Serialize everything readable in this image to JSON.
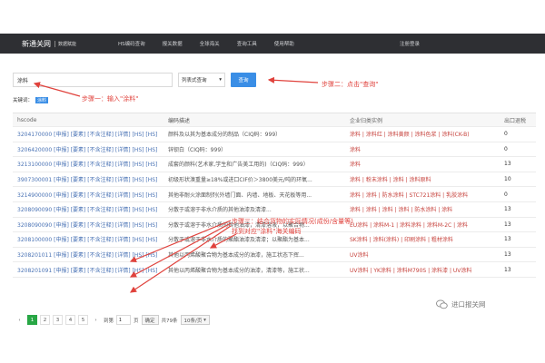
{
  "navbar": {
    "brand": "新通关网",
    "brand_sub": "数据赋能",
    "items": [
      "HS编码查询",
      "报关数据",
      "全球海关",
      "查询工具",
      "使用帮助"
    ],
    "right": "注册登录"
  },
  "search": {
    "value": "涂料",
    "mode": "列表式查询",
    "button": "查询"
  },
  "keyword": {
    "label": "关键词：",
    "tag": "涂料"
  },
  "annotations": {
    "step1": "步骤一：输入\"涂料\"",
    "step2": "步骤二：点击\"查询\"",
    "step3_line1": "步骤三：结合货物的实际情况(成份/含量等)",
    "step3_line2": "找到对应\"涂料\"海关编码"
  },
  "table": {
    "headers": [
      "hscode",
      "编码描述",
      "企业归类实例",
      "出口退税"
    ],
    "rows": [
      {
        "code": "3204170000",
        "links": "[申报] [要素] [不含注释] [详情] [HS] [HS]",
        "desc": "颜料及以其为基本成分的制品（CIQ码：999）",
        "examples": "涂料 | 涂料红 | 涂料黄颜 | 涂料色浆 | 涂料(CK-B)",
        "rebate": "0"
      },
      {
        "code": "3206420000",
        "links": "[申报] [要素] [不含注释] [详情] [HS] [HS]",
        "desc": "锌钡白（CIQ码：999）",
        "examples": "涂料",
        "rebate": "0"
      },
      {
        "code": "3213100000",
        "links": "[申报] [要素] [不含注释] [详情] [HS] [HS]",
        "desc": "成套的颜料(艺术家,学生和广告美工用的)（CIQ码：999）",
        "examples": "涂料",
        "rebate": "13"
      },
      {
        "code": "3907300001",
        "links": "[申报] [要素] [不含注释] [详情] [HS] [HS]",
        "desc": "初级形状溴重量≥18%或进口CIF价＞3800美元/吨的环氧...",
        "examples": "涂料 | 粉末涂料 | 涂料 | 涂料原料",
        "rebate": "10"
      },
      {
        "code": "3214900000",
        "links": "[申报] [要素] [不含注释] [详情] [HS] [HS]",
        "desc": "其他非耐火涂面制剂(外墙门面、内墙、地板、天花板等用...",
        "examples": "涂料 | 涂料 | 防水涂料 | STC721涂料 | 乳胶涂料",
        "rebate": "0"
      },
      {
        "code": "3208090090",
        "links": "[申报] [要素] [不含注释] [详情] [HS] [HS]",
        "desc": "分散于或溶于非水介质的其他油漆及清漆...",
        "examples": "涂料 | 涂料 | 涂料 | 涂料 | 防水涂料 | 涂料",
        "rebate": "13"
      },
      {
        "code": "3208090090",
        "links": "[申报] [要素] [不含注释] [详情] [HS] [HS]",
        "desc": "分散于或溶于非水介质的其他油漆，清漆溶液，以聚合物...",
        "examples": "EU涂料 | 涂料M-1 | 涂料涂料 | 涂料M-2C | 涂料",
        "rebate": "13"
      },
      {
        "code": "3208100000",
        "links": "[申报] [要素] [不含注释] [详情] [HS] [HS]",
        "desc": "分散于或溶于非水介质的聚酯油漆及清漆；以聚酯为基本...",
        "examples": "SK涂料 | 涂料(涂料) | 印刷涂料 | 粗材涂料",
        "rebate": "13"
      },
      {
        "code": "3208201011",
        "links": "[申报] [要素] [不含注释] [详情] [HS] [HS]",
        "desc": "其他以丙烯酸聚合物为基本成分的油漆，施工状态下挥...",
        "examples": "UV涂料",
        "rebate": "13"
      },
      {
        "code": "3208201091",
        "links": "[申报] [要素] [不含注释] [详情] [HS] [HS]",
        "desc": "其他以丙烯酸聚合物为基本成分的油漆，清漆等，施工状...",
        "examples": "UV涂料 | YK涂料 | 涂料M790S | 涂料漆 | UV涂料",
        "rebate": "13"
      }
    ]
  },
  "pager": {
    "pages": [
      "1",
      "2",
      "3",
      "4",
      "5"
    ],
    "active": "1",
    "goto_label": "到第",
    "goto_value": "1",
    "page_unit": "页",
    "go_button": "确定",
    "total": "共79条",
    "per_page": "10条/页"
  },
  "watermark": "进口报关网",
  "colors": {
    "navbar": "#2e2f33",
    "accent": "#3a8ee6",
    "annotation": "#e0423c",
    "pager_active": "#28a745"
  }
}
